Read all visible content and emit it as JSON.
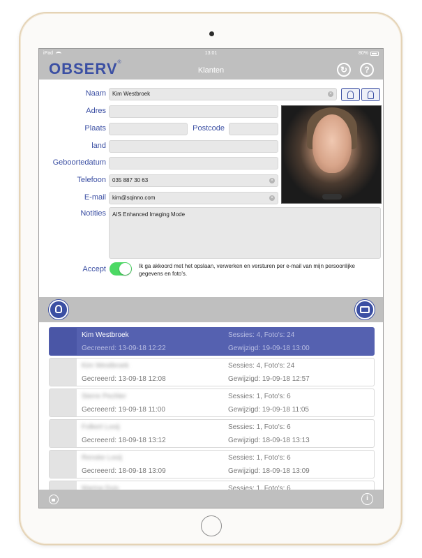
{
  "status_bar": {
    "device": "iPad",
    "time": "13:01",
    "battery": "80%"
  },
  "nav": {
    "logo": "OBSERV",
    "logo_mark": "®",
    "title": "Klanten",
    "help_icon": "?"
  },
  "form": {
    "name_label": "Naam",
    "name_value": "Kim Westbroek",
    "address_label": "Adres",
    "address_value": "",
    "city_label": "Plaats",
    "city_value": "",
    "postcode_label": "Postcode",
    "postcode_value": "",
    "country_label": "land",
    "country_value": "",
    "birthdate_label": "Geboortedatum",
    "birthdate_value": "",
    "phone_label": "Telefoon",
    "phone_value": "035 887 30 63",
    "email_label": "E-mail",
    "email_value": "kim@sqinno.com",
    "notes_label": "Notities",
    "notes_value": "AIS Enhanced Imaging Mode",
    "accept_label": "Accept",
    "accept_text": "Ik ga akkoord met het opslaan, verwerken en versturen per e-mail van mijn persoonlijke gegevens en foto's.",
    "accept_on": true
  },
  "clients": [
    {
      "name": "Kim Westbroek",
      "created": "Gecreeerd: 13-09-18 12:22",
      "sessions": "Sessies: 4, Foto's: 24",
      "modified": "Gewijzigd: 19-09-18 13:00",
      "selected": true
    },
    {
      "name": "Kim Westbroek",
      "created": "Gecreeerd: 13-09-18 12:08",
      "sessions": "Sessies: 4, Foto's: 24",
      "modified": "Gewijzigd: 19-09-18 12:57",
      "selected": false
    },
    {
      "name": "Sterre Pechler",
      "created": "Gecreeerd: 19-09-18 11:00",
      "sessions": "Sessies: 1, Foto's: 6",
      "modified": "Gewijzigd: 19-09-18 11:05",
      "selected": false
    },
    {
      "name": "Folkert Looij",
      "created": "Gecreeerd: 18-09-18 13:12",
      "sessions": "Sessies: 1, Foto's: 6",
      "modified": "Gewijzigd: 18-09-18 13:13",
      "selected": false
    },
    {
      "name": "Renske Looij",
      "created": "Gecreeerd: 18-09-18 13:09",
      "sessions": "Sessies: 1, Foto's: 6",
      "modified": "Gewijzigd: 18-09-18 13:09",
      "selected": false
    },
    {
      "name": "Marina Duis",
      "created": "",
      "sessions": "Sessies: 1, Foto's: 6",
      "modified": "",
      "selected": false
    }
  ],
  "colors": {
    "accent": "#3b4fa3",
    "selected_row": "#5561b0",
    "toggle_on": "#4cd964",
    "bar": "#bfbfbf"
  },
  "icons": [
    "wifi-icon",
    "battery-icon",
    "history-icon",
    "help-icon",
    "person-male-icon",
    "person-female-icon",
    "clear-icon",
    "face-icon",
    "camera-icon",
    "lock-icon",
    "info-icon"
  ]
}
